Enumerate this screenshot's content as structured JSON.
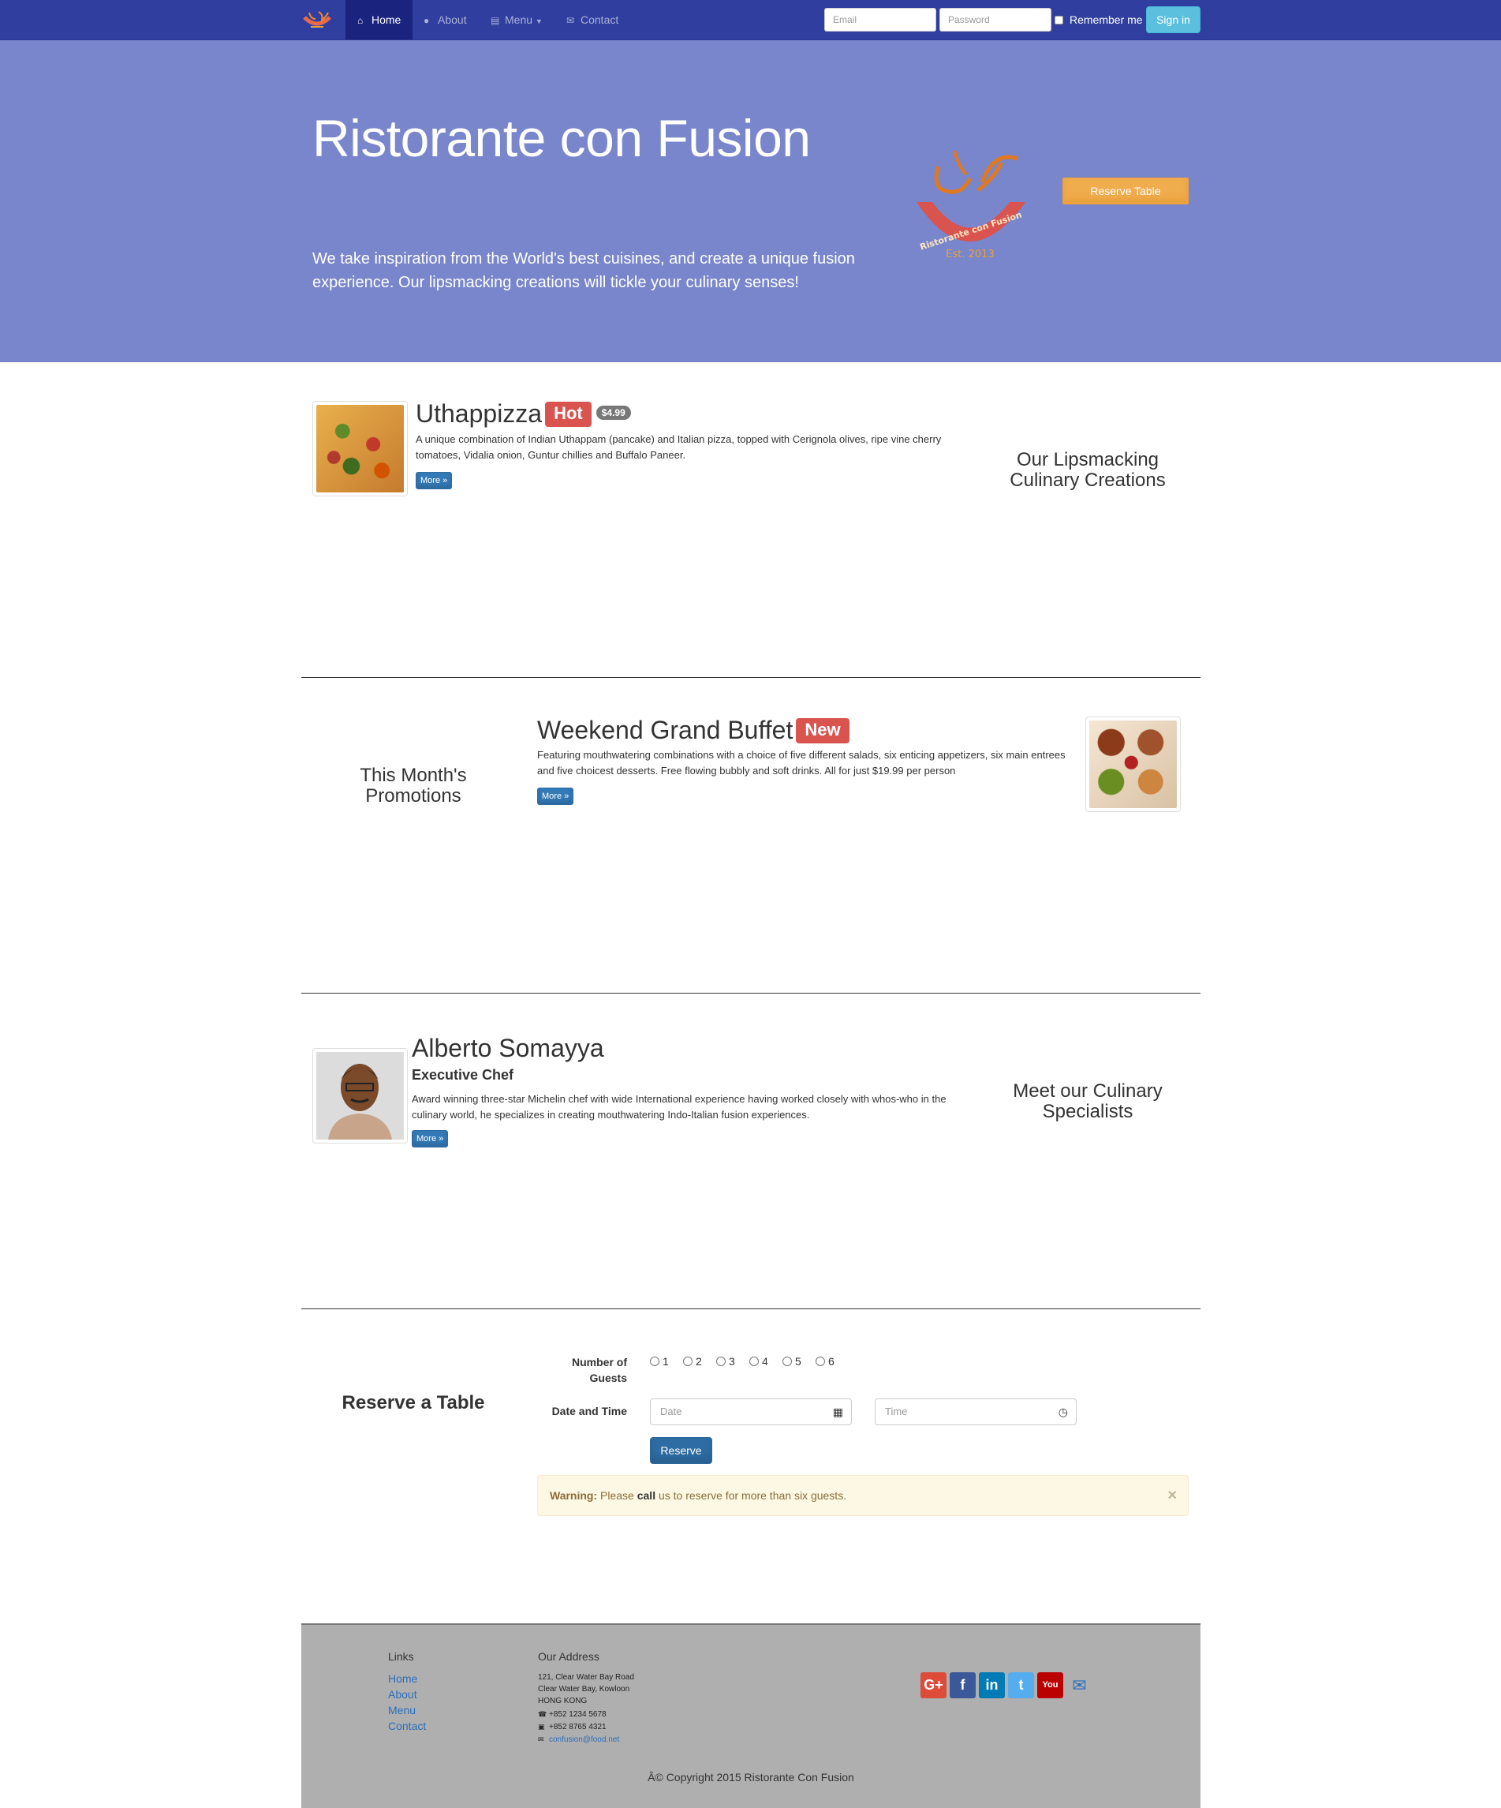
{
  "nav": {
    "items": [
      {
        "label": "Home",
        "icon": "home-icon",
        "active": true
      },
      {
        "label": "About",
        "icon": "info-sign-icon"
      },
      {
        "label": "Menu",
        "icon": "list-alt-icon",
        "caret": true
      },
      {
        "label": "Contact",
        "icon": "envelope-icon"
      }
    ],
    "email_placeholder": "Email",
    "password_placeholder": "Password",
    "remember_label": "Remember me",
    "signin_label": "Sign in"
  },
  "jumbotron": {
    "title": "Ristorante con Fusion",
    "description": "We take inspiration from the World's best cuisines, and create a unique fusion experience. Our lipsmacking creations will tickle your culinary senses!",
    "logo_text": "Ristorante con Fusion",
    "logo_est": "Est. 2013",
    "reserve_label": "Reserve Table"
  },
  "dish": {
    "title": "Uthappizza",
    "badge": "Hot",
    "price": "$4.99",
    "description": "A unique combination of Indian Uthappam (pancake) and Italian pizza, topped with Cerignola olives, ripe vine cherry tomatoes, Vidalia onion, Guntur chillies and Buffalo Paneer.",
    "more_label": "More »",
    "side_heading": "Our Lipsmacking Culinary Creations"
  },
  "promotion": {
    "title": "Weekend Grand Buffet",
    "badge": "New",
    "description": "Featuring mouthwatering combinations with a choice of five different salads, six enticing appetizers, six main entrees and five choicest desserts. Free flowing bubbly and soft drinks. All for just $19.99 per person",
    "more_label": "More »",
    "side_heading": "This Month's Promotions"
  },
  "chef": {
    "name": "Alberto Somayya",
    "role": "Executive Chef",
    "description": "Award winning three-star Michelin chef with wide International experience having worked closely with whos-who in the culinary world, he specializes in creating mouthwatering Indo-Italian fusion experiences.",
    "more_label": "More »",
    "side_heading": "Meet our Culinary Specialists"
  },
  "reservation": {
    "heading": "Reserve a Table",
    "guests_label": "Number of Guests",
    "guest_options": [
      "1",
      "2",
      "3",
      "4",
      "5",
      "6"
    ],
    "datetime_label": "Date and Time",
    "date_placeholder": "Date",
    "time_placeholder": "Time",
    "submit_label": "Reserve",
    "warning": {
      "strong": "Warning:",
      "pre": "Please",
      "emph": "call",
      "post": "us to reserve for more than six guests.",
      "close": "×"
    }
  },
  "footer": {
    "links_heading": "Links",
    "links": [
      "Home",
      "About",
      "Menu",
      "Contact"
    ],
    "address_heading": "Our Address",
    "address_lines": [
      "121, Clear Water Bay Road",
      "Clear Water Bay, Kowloon",
      "HONG KONG"
    ],
    "phone": "+852 1234 5678",
    "fax": "+852 8765 4321",
    "email": "confusion@food.net",
    "social": [
      {
        "name": "google-plus-icon",
        "glyph": "G+",
        "color": "#dd4b39"
      },
      {
        "name": "facebook-icon",
        "glyph": "f",
        "color": "#3b5998"
      },
      {
        "name": "linkedin-icon",
        "glyph": "in",
        "color": "#007bb6"
      },
      {
        "name": "twitter-icon",
        "glyph": "t",
        "color": "#55acee"
      },
      {
        "name": "youtube-icon",
        "glyph": "You",
        "color": "#bb0000"
      }
    ],
    "copyright": "Â© Copyright 2015 Ristorante Con Fusion"
  },
  "colors": {
    "navbar": "#303f9f",
    "navbar_active": "#1a237e",
    "jumbotron": "#7986cb",
    "badge_red": "#d9534f",
    "primary": "#337ab7",
    "warning_button": "#f0ad4e",
    "footer": "#afafaf"
  }
}
